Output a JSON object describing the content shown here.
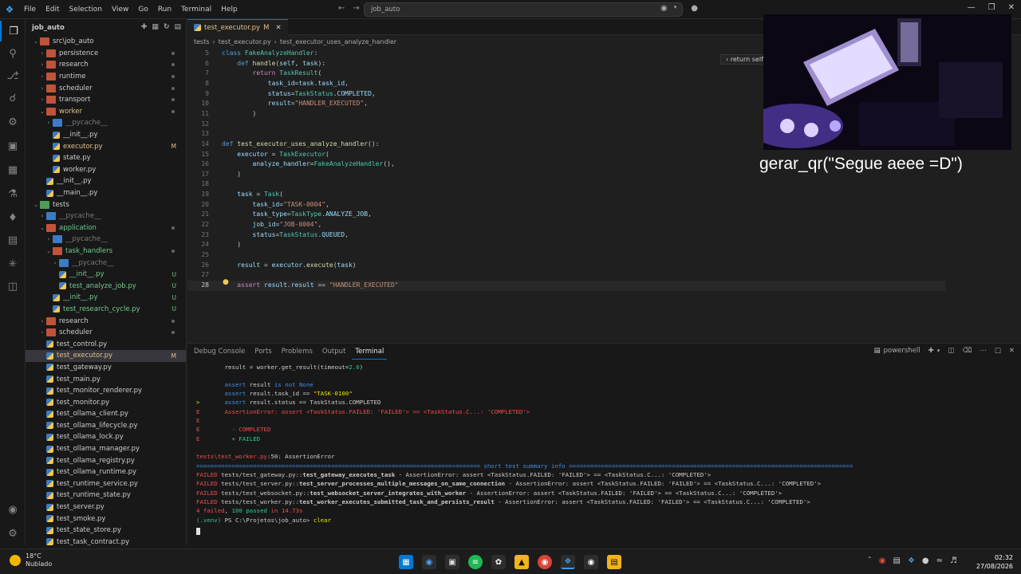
{
  "titlebar": {
    "menu": [
      "File",
      "Edit",
      "Selection",
      "View",
      "Go",
      "Run",
      "Terminal",
      "Help"
    ],
    "search": "job_auto"
  },
  "sidebar": {
    "root": "job_auto",
    "items": [
      {
        "label": "src\\job_auto",
        "kind": "folder-open",
        "indent": 1
      },
      {
        "label": "persistence",
        "kind": "folder",
        "indent": 2
      },
      {
        "label": "research",
        "kind": "folder",
        "indent": 2
      },
      {
        "label": "runtime",
        "kind": "folder",
        "indent": 2
      },
      {
        "label": "scheduler",
        "kind": "folder",
        "indent": 2
      },
      {
        "label": "transport",
        "kind": "folder",
        "indent": 2
      },
      {
        "label": "worker",
        "kind": "folder-open",
        "indent": 2,
        "color": "#e2c08d"
      },
      {
        "label": "__pycache__",
        "kind": "folder-blue",
        "indent": 3,
        "dim": true
      },
      {
        "label": "__init__.py",
        "kind": "py",
        "indent": 3
      },
      {
        "label": "executor.py",
        "kind": "py",
        "indent": 3,
        "badge": "M",
        "color": "#e2c08d"
      },
      {
        "label": "state.py",
        "kind": "py",
        "indent": 3
      },
      {
        "label": "worker.py",
        "kind": "py",
        "indent": 3
      },
      {
        "label": "__init__.py",
        "kind": "py",
        "indent": 2
      },
      {
        "label": "__main__.py",
        "kind": "py",
        "indent": 2
      },
      {
        "label": "tests",
        "kind": "folder-open-green",
        "indent": 1
      },
      {
        "label": "__pycache__",
        "kind": "folder-blue",
        "indent": 2,
        "dim": true
      },
      {
        "label": "application",
        "kind": "folder-open",
        "indent": 2,
        "color": "#73c991"
      },
      {
        "label": "__pycache__",
        "kind": "folder-blue",
        "indent": 3,
        "dim": true
      },
      {
        "label": "task_handlers",
        "kind": "folder-open",
        "indent": 3,
        "color": "#73c991"
      },
      {
        "label": "__pycache__",
        "kind": "folder-blue",
        "indent": 4,
        "dim": true
      },
      {
        "label": "__init__.py",
        "kind": "py",
        "indent": 4,
        "badge": "U",
        "color": "#73c991"
      },
      {
        "label": "test_analyze_job.py",
        "kind": "py",
        "indent": 4,
        "badge": "U",
        "color": "#73c991"
      },
      {
        "label": "__init__.py",
        "kind": "py",
        "indent": 3,
        "badge": "U",
        "color": "#73c991"
      },
      {
        "label": "test_research_cycle.py",
        "kind": "py",
        "indent": 3,
        "badge": "U",
        "color": "#73c991"
      },
      {
        "label": "research",
        "kind": "folder",
        "indent": 2
      },
      {
        "label": "scheduler",
        "kind": "folder",
        "indent": 2
      },
      {
        "label": "test_control.py",
        "kind": "py",
        "indent": 2
      },
      {
        "label": "test_executor.py",
        "kind": "py",
        "indent": 2,
        "badge": "M",
        "color": "#e2c08d",
        "selected": true
      },
      {
        "label": "test_gateway.py",
        "kind": "py",
        "indent": 2
      },
      {
        "label": "test_main.py",
        "kind": "py",
        "indent": 2
      },
      {
        "label": "test_monitor_renderer.py",
        "kind": "py",
        "indent": 2
      },
      {
        "label": "test_monitor.py",
        "kind": "py",
        "indent": 2
      },
      {
        "label": "test_ollama_client.py",
        "kind": "py",
        "indent": 2
      },
      {
        "label": "test_ollama_lifecycle.py",
        "kind": "py",
        "indent": 2
      },
      {
        "label": "test_ollama_lock.py",
        "kind": "py",
        "indent": 2
      },
      {
        "label": "test_ollama_manager.py",
        "kind": "py",
        "indent": 2
      },
      {
        "label": "test_ollama_registry.py",
        "kind": "py",
        "indent": 2
      },
      {
        "label": "test_ollama_runtime.py",
        "kind": "py",
        "indent": 2
      },
      {
        "label": "test_runtime_service.py",
        "kind": "py",
        "indent": 2
      },
      {
        "label": "test_runtime_state.py",
        "kind": "py",
        "indent": 2
      },
      {
        "label": "test_server.py",
        "kind": "py",
        "indent": 2
      },
      {
        "label": "test_smoke.py",
        "kind": "py",
        "indent": 2
      },
      {
        "label": "test_state_store.py",
        "kind": "py",
        "indent": 2
      },
      {
        "label": "test_task_contract.py",
        "kind": "py",
        "indent": 2
      }
    ]
  },
  "editor": {
    "tab": {
      "label": "test_executor.py",
      "badge": "M"
    },
    "breadcrumb": [
      "tests",
      "test_executor.py",
      "test_executor_uses_analyze_handler"
    ],
    "sticky_hint": "return self",
    "lines": [
      {
        "n": "5",
        "html": "<span class='kw'>class</span> <span class='cls'>FakeAnalyzeHandler</span>:"
      },
      {
        "n": "6",
        "html": "    <span class='kw'>def</span> <span class='fn'>handle</span>(<span class='var'>self</span>, <span class='var'>task</span>):"
      },
      {
        "n": "7",
        "html": "        <span class='ctl'>return</span> <span class='cls'>TaskResult</span>("
      },
      {
        "n": "8",
        "html": "            <span class='var'>task_id</span>=<span class='var'>task</span>.<span class='var'>task_id</span>,"
      },
      {
        "n": "9",
        "html": "            <span class='var'>status</span>=<span class='cls'>TaskStatus</span>.<span class='var'>COMPLETED</span>,"
      },
      {
        "n": "10",
        "html": "            <span class='var'>result</span>=<span class='str'>\"HANDLER_EXECUTED\"</span>,"
      },
      {
        "n": "11",
        "html": "        )"
      },
      {
        "n": "12",
        "html": ""
      },
      {
        "n": "13",
        "html": ""
      },
      {
        "n": "14",
        "html": "<span class='kw'>def</span> <span class='fn'>test_executor_uses_analyze_handler</span>():"
      },
      {
        "n": "15",
        "html": "    <span class='var'>executor</span> = <span class='cls'>TaskExecutor</span>("
      },
      {
        "n": "16",
        "html": "        <span class='var'>analyze_handler</span>=<span class='cls'>FakeAnalyzeHandler</span>(),"
      },
      {
        "n": "17",
        "html": "    )"
      },
      {
        "n": "18",
        "html": ""
      },
      {
        "n": "19",
        "html": "    <span class='var'>task</span> = <span class='cls'>Task</span>("
      },
      {
        "n": "20",
        "html": "        <span class='var'>task_id</span>=<span class='str'>\"TASK-0004\"</span>,"
      },
      {
        "n": "21",
        "html": "        <span class='var'>task_type</span>=<span class='cls'>TaskType</span>.<span class='var'>ANALYZE_JOB</span>,"
      },
      {
        "n": "22",
        "html": "        <span class='var'>job_id</span>=<span class='str'>\"JOB-0004\"</span>,"
      },
      {
        "n": "23",
        "html": "        <span class='var'>status</span>=<span class='cls'>TaskStatus</span>.<span class='var'>QUEUED</span>,"
      },
      {
        "n": "24",
        "html": "    )"
      },
      {
        "n": "25",
        "html": ""
      },
      {
        "n": "26",
        "html": "    <span class='var'>result</span> = <span class='var'>executor</span>.<span class='fn'>execute</span>(<span class='var'>task</span>)"
      },
      {
        "n": "27",
        "html": ""
      },
      {
        "n": "28",
        "html": "    <span class='ctl'>assert</span> <span class='var'>result</span>.<span class='var'>result</span> == <span class='str'>\"HANDLER_EXECUTED\"</span>",
        "current": true
      }
    ]
  },
  "overlay": {
    "caption": "gerar_qr(\"Segue aeee =D\")"
  },
  "panel": {
    "tabs": [
      "Debug Console",
      "Ports",
      "Problems",
      "Output",
      "Terminal"
    ],
    "active_tab": "Terminal",
    "shell": "powershell",
    "lines": [
      {
        "y": 0,
        "html": "        result = worker.get_result(timeout=<span class='grn'>2.0</span>)"
      },
      {
        "y": 1.95,
        "html": "        <span class='blue'>assert</span> result <span class='blue'>is not None</span>"
      },
      {
        "y": 2.9,
        "html": "        <span class='blue'>assert</span> result.task_id == <span class='yel'>\"TASK-0100\"</span>"
      },
      {
        "y": 3.9,
        "html": "<span class='yel'>&gt;</span>       <span class='blue'>assert</span> result.status == TaskStatus.COMPLETED"
      },
      {
        "y": 4.9,
        "html": "<span class='red'>E       AssertionError: assert &lt;TaskStatus.FAILED: 'FAILED'&gt; == &lt;TaskStatus.C...: 'COMPLETED'&gt;</span>"
      },
      {
        "y": 5.9,
        "html": "<span class='red'>E</span>"
      },
      {
        "y": 6.9,
        "html": "<span class='red'>E         - COMPLETED</span>"
      },
      {
        "y": 7.9,
        "html": "<span class='red'>E         </span><span class='grn'>+ FAILED</span>"
      },
      {
        "y": 9.9,
        "html": "<span class='red'>tests\\test_worker.py</span>:50: AssertionError"
      },
      {
        "y": 10.9,
        "html": "<span class='blue'>================================================================================ short test summary info ================================================================================</span>"
      },
      {
        "y": 11.9,
        "html": "<span class='red'>FAILED</span> tests/test_gateway.py::<b>test_gateway_executes_task</b> - AssertionError: assert &lt;TaskStatus.FAILED: 'FAILED'&gt; == &lt;TaskStatus.C...: 'COMPLETED'&gt;"
      },
      {
        "y": 12.9,
        "html": "<span class='red'>FAILED</span> tests/test_server.py::<b>test_server_processes_multiple_messages_on_same_connection</b> - AssertionError: assert &lt;TaskStatus.FAILED: 'FAILED'&gt; == &lt;TaskStatus.C...: 'COMPLETED'&gt;"
      },
      {
        "y": 13.9,
        "html": "<span class='red'>FAILED</span> tests/test_websocket.py::<b>test_websocket_server_integrates_with_worker</b> - AssertionError: assert &lt;TaskStatus.FAILED: 'FAILED'&gt; == &lt;TaskStatus.C...: 'COMPLETED'&gt;"
      },
      {
        "y": 14.9,
        "html": "<span class='red'>FAILED</span> tests/test_worker.py::<b>test_worker_executes_submitted_task_and_persists_result</b> - AssertionError: assert &lt;TaskStatus.FAILED: 'FAILED'&gt; == &lt;TaskStatus.C...: 'COMPLETED'&gt;"
      },
      {
        "y": 15.9,
        "html": "<span class='red'>4 failed</span>, <span class='grn'>100 passed</span> <span class='red'>in 14.73s</span>"
      },
      {
        "y": 16.9,
        "html": "<span class='grn'>(.venv)</span> PS C:\\Projetos\\job_auto&gt; <span class='yel'>clear</span>"
      }
    ]
  },
  "taskbar": {
    "temp": "18°C",
    "weather": "Nublado",
    "time": "02:32",
    "date": "27/08/2026"
  },
  "colors": {
    "accent": "#0078d4",
    "modified": "#e2c08d",
    "untracked": "#73c991"
  }
}
